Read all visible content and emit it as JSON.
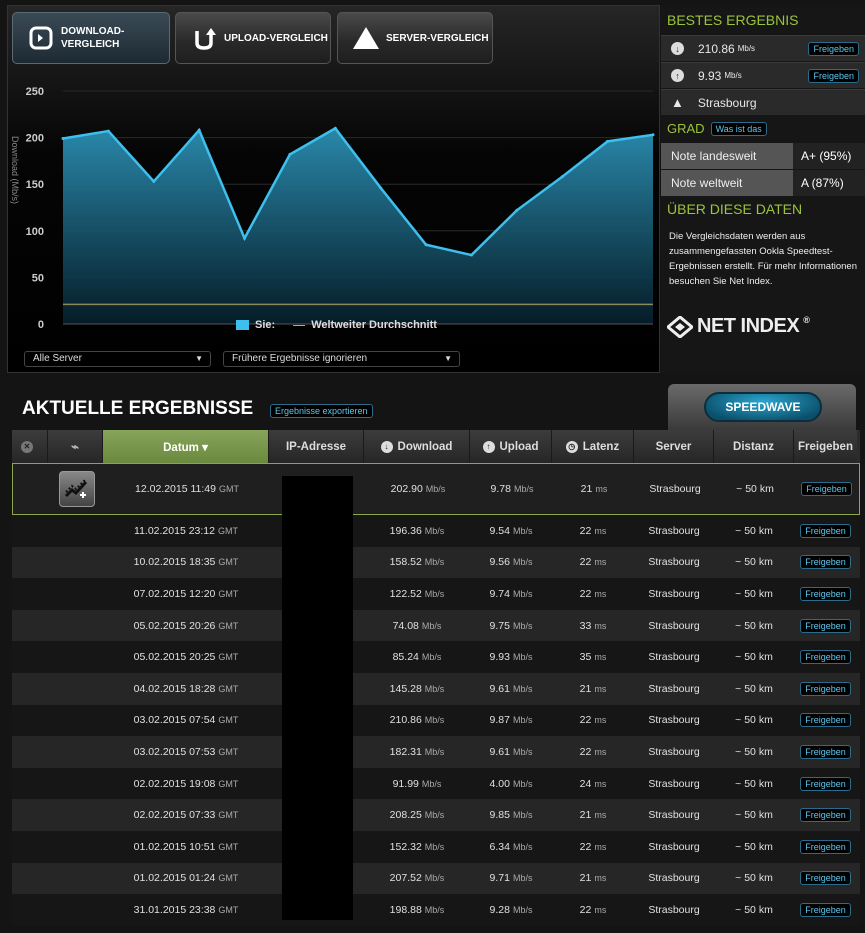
{
  "tabs": [
    {
      "label": "DOWNLOAD-\nVERGLEICH",
      "icon": "download-compare-icon"
    },
    {
      "label": "UPLOAD-VERGLEICH",
      "icon": "upload-compare-icon"
    },
    {
      "label": "SERVER-VERGLEICH",
      "icon": "server-triangle-icon"
    }
  ],
  "chart_data": {
    "type": "line",
    "ylim": [
      0,
      250
    ],
    "yticks": [
      "250",
      "200",
      "150",
      "100",
      "50",
      "0"
    ],
    "ylabel": "Download (Mb/s)",
    "series": [
      {
        "name": "Sie:",
        "values": [
          199,
          207,
          153,
          208,
          92,
          182,
          210,
          146,
          85,
          74,
          122,
          158,
          196,
          203
        ]
      },
      {
        "name": "Weltweiter Durchschnitt",
        "values": [
          21,
          21,
          21,
          21,
          21,
          21,
          21,
          21,
          21,
          21,
          21,
          21,
          21,
          21
        ]
      }
    ],
    "colors": {
      "user": "#3ec0ef",
      "average": "#8a8a5a"
    }
  },
  "filters": {
    "server": "Alle Server",
    "previous": "Frühere Ergebnisse ignorieren"
  },
  "best": {
    "title": "BESTES ERGEBNIS",
    "download": "210.86",
    "download_unit": "Mb/s",
    "upload": "9.93",
    "upload_unit": "Mb/s",
    "server": "Strasbourg",
    "share_label": "Freigeben"
  },
  "grade": {
    "title": "GRAD",
    "what_label": "Was ist das",
    "national_label": "Note landesweit",
    "national_value": "A+ (95%)",
    "world_label": "Note weltweit",
    "world_value": "A (87%)"
  },
  "about": {
    "title": "ÜBER DIESE DATEN",
    "text": "Die Vergleichsdaten werden aus zusammengefassten Ookla Speedtest-Ergebnissen erstellt. Für mehr Informationen besuchen Sie Net Index.",
    "logo": "NET INDEX"
  },
  "results": {
    "title": "AKTUELLE ERGEBNISSE",
    "export_label": "Ergebnisse exportieren",
    "speedwave_label": "SPEEDWAVE",
    "headers": [
      "Datum ▾",
      "IP-Adresse",
      "Download",
      "Upload",
      "Latenz",
      "Server",
      "Distanz",
      "Freigeben"
    ],
    "rows": [
      {
        "date": "12.02.2015 11:49",
        "tz": "GMT",
        "down": "202.90",
        "up": "9.78",
        "lat": "21",
        "server": "Strasbourg",
        "dist": "~ 50 km"
      },
      {
        "date": "11.02.2015 23:12",
        "tz": "GMT",
        "down": "196.36",
        "up": "9.54",
        "lat": "22",
        "server": "Strasbourg",
        "dist": "~ 50 km"
      },
      {
        "date": "10.02.2015 18:35",
        "tz": "GMT",
        "down": "158.52",
        "up": "9.56",
        "lat": "22",
        "server": "Strasbourg",
        "dist": "~ 50 km"
      },
      {
        "date": "07.02.2015 12:20",
        "tz": "GMT",
        "down": "122.52",
        "up": "9.74",
        "lat": "22",
        "server": "Strasbourg",
        "dist": "~ 50 km"
      },
      {
        "date": "05.02.2015 20:26",
        "tz": "GMT",
        "down": "74.08",
        "up": "9.75",
        "lat": "33",
        "server": "Strasbourg",
        "dist": "~ 50 km"
      },
      {
        "date": "05.02.2015 20:25",
        "tz": "GMT",
        "down": "85.24",
        "up": "9.93",
        "lat": "35",
        "server": "Strasbourg",
        "dist": "~ 50 km"
      },
      {
        "date": "04.02.2015 18:28",
        "tz": "GMT",
        "down": "145.28",
        "up": "9.61",
        "lat": "21",
        "server": "Strasbourg",
        "dist": "~ 50 km"
      },
      {
        "date": "03.02.2015 07:54",
        "tz": "GMT",
        "down": "210.86",
        "up": "9.87",
        "lat": "22",
        "server": "Strasbourg",
        "dist": "~ 50 km"
      },
      {
        "date": "03.02.2015 07:53",
        "tz": "GMT",
        "down": "182.31",
        "up": "9.61",
        "lat": "22",
        "server": "Strasbourg",
        "dist": "~ 50 km"
      },
      {
        "date": "02.02.2015 19:08",
        "tz": "GMT",
        "down": "91.99",
        "up": "4.00",
        "lat": "24",
        "server": "Strasbourg",
        "dist": "~ 50 km"
      },
      {
        "date": "02.02.2015 07:33",
        "tz": "GMT",
        "down": "208.25",
        "up": "9.85",
        "lat": "21",
        "server": "Strasbourg",
        "dist": "~ 50 km"
      },
      {
        "date": "01.02.2015 10:51",
        "tz": "GMT",
        "down": "152.32",
        "up": "6.34",
        "lat": "22",
        "server": "Strasbourg",
        "dist": "~ 50 km"
      },
      {
        "date": "01.02.2015 01:24",
        "tz": "GMT",
        "down": "207.52",
        "up": "9.71",
        "lat": "21",
        "server": "Strasbourg",
        "dist": "~ 50 km"
      },
      {
        "date": "31.01.2015 23:38",
        "tz": "GMT",
        "down": "198.88",
        "up": "9.28",
        "lat": "22",
        "server": "Strasbourg",
        "dist": "~ 50 km"
      }
    ],
    "units": {
      "speed": "Mb/s",
      "latency": "ms"
    },
    "share_label": "Freigeben"
  }
}
